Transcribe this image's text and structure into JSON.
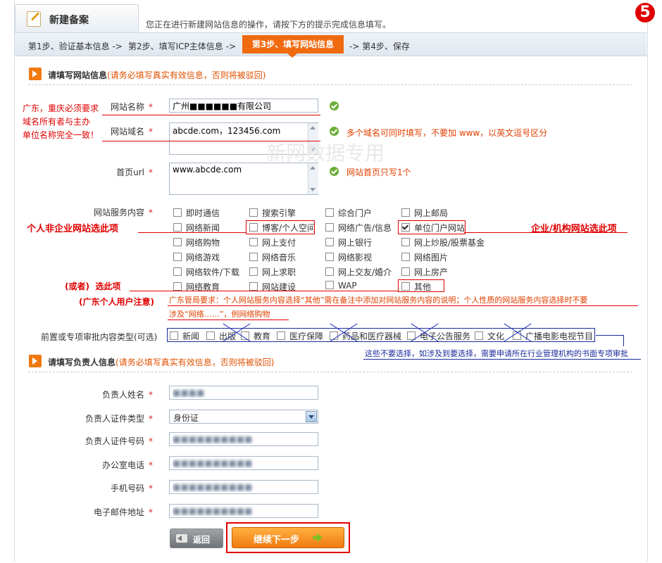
{
  "header": {
    "title": "新建备案",
    "intro": "您正在进行新建网站信息的操作，请按下方的提示完成信息填写。",
    "step_badge": "5"
  },
  "steps": {
    "step1": "第1步、验证基本信息",
    "step2": "第2步、填写ICP主体信息",
    "step3": "第3步、填写网站信息",
    "step4": "第4步、保存",
    "arrow": "->"
  },
  "section1": {
    "title": "请填写网站信息",
    "note": "(请务必填写真实有效信息，否则将被驳回)"
  },
  "fields": {
    "site_name_label": "网站名称",
    "site_name_value": "广州■■■■■■有限公司",
    "domain_label": "网站域名",
    "domain_value": "abcde.com，123456.com",
    "domain_hint": "多个域名可同时填写，不要加 www，以英文逗号区分",
    "home_url_label": "首页url",
    "home_url_value": "www.abcde.com",
    "home_url_hint": "网站首页只写1个",
    "service_label": "网站服务内容",
    "required_mark": "*",
    "prior_label": "前置或专项审批内容类型(可选)"
  },
  "services": [
    {
      "label": "即时通信",
      "checked": false
    },
    {
      "label": "搜索引擎",
      "checked": false
    },
    {
      "label": "综合门户",
      "checked": false
    },
    {
      "label": "网上邮局",
      "checked": false
    },
    {
      "label": "网络新闻",
      "checked": false
    },
    {
      "label": "博客/个人空间",
      "checked": false
    },
    {
      "label": "网络广告/信息",
      "checked": false
    },
    {
      "label": "单位门户网站",
      "checked": true
    },
    {
      "label": "网络购物",
      "checked": false
    },
    {
      "label": "网上支付",
      "checked": false
    },
    {
      "label": "网上银行",
      "checked": false
    },
    {
      "label": "网上炒股/股票基金",
      "checked": false
    },
    {
      "label": "网络游戏",
      "checked": false
    },
    {
      "label": "网络音乐",
      "checked": false
    },
    {
      "label": "网络影视",
      "checked": false
    },
    {
      "label": "网络图片",
      "checked": false
    },
    {
      "label": "网络软件/下载",
      "checked": false
    },
    {
      "label": "网上求职",
      "checked": false
    },
    {
      "label": "网上交友/婚介",
      "checked": false
    },
    {
      "label": "网上房产",
      "checked": false
    },
    {
      "label": "网络教育",
      "checked": false
    },
    {
      "label": "网站建设",
      "checked": false
    },
    {
      "label": "WAP",
      "checked": false
    },
    {
      "label": "其他",
      "checked": false
    }
  ],
  "prior": [
    {
      "label": "新闻"
    },
    {
      "label": "出版"
    },
    {
      "label": "教育"
    },
    {
      "label": "医疗保障"
    },
    {
      "label": "药品和医疗器械"
    },
    {
      "label": "电子公告服务"
    },
    {
      "label": "文化"
    },
    {
      "label": "广播电影电视节目"
    }
  ],
  "annotations": {
    "left_note_1": "广东，重庆必须要求",
    "left_note_2": "域名所有者与主办",
    "left_note_3": "单位名称完全一致！",
    "personal_note": "个人非企业网站选此项",
    "company_note": "企业/机构网站选此项",
    "or_note": "(或者)",
    "or_note_2": "选此项",
    "gd_personal": "(广东个人用户注意)",
    "gd_rule_1": "广东管局要求：个人网站服务内容选择“其他”需在备注中添加对网站服务内容的说明；个人性质的网站服务内容选择时不要",
    "gd_rule_2": "涉及“网络……”，例网络购物",
    "prior_note": "这些不要选择，如涉及到要选择，需要申请所在行业管理机构的书面专项审批",
    "watermark": "新网数据专用"
  },
  "section2": {
    "title": "请填写负责人信息",
    "note": "(请务必填写真实有效信息，否则将被驳回)"
  },
  "person": {
    "name_label": "负责人姓名",
    "name_value": "■■■■",
    "id_type_label": "负责人证件类型",
    "id_type_value": "身份证",
    "id_no_label": "负责人证件号码",
    "id_no_value": "■■■■■■■■■■",
    "office_label": "办公室电话",
    "office_value": "■■■■■■■■■■",
    "mobile_label": "手机号码",
    "mobile_value": "■■■■■■■■■■",
    "email_label": "电子邮件地址",
    "email_value": "■■■■■■■■■■"
  },
  "buttons": {
    "back": "返回",
    "next": "继续下一步"
  },
  "colors": {
    "accent_orange": "#f07a10",
    "step_active": "#f06a10",
    "annotation_red": "#e00000",
    "annotation_blue": "#1a2a9a"
  }
}
